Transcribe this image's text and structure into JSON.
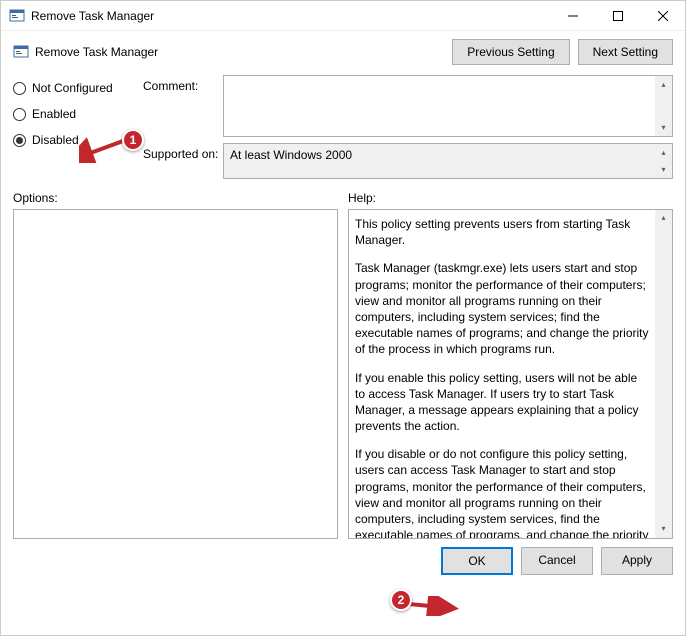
{
  "window": {
    "title": "Remove Task Manager",
    "policy_name": "Remove Task Manager"
  },
  "nav": {
    "previous": "Previous Setting",
    "next": "Next Setting"
  },
  "config": {
    "not_configured": "Not Configured",
    "enabled": "Enabled",
    "disabled": "Disabled",
    "selected": "disabled"
  },
  "fields": {
    "comment_label": "Comment:",
    "comment_value": "",
    "supported_label": "Supported on:",
    "supported_value": "At least Windows 2000"
  },
  "sections": {
    "options_label": "Options:",
    "help_label": "Help:"
  },
  "help": {
    "p1": "This policy setting prevents users from starting Task Manager.",
    "p2": "Task Manager (taskmgr.exe) lets users start and stop programs; monitor the performance of their computers; view and monitor all programs running on their computers, including system services; find the executable names of programs; and change the priority of the process in which programs run.",
    "p3": "If you enable this policy setting, users will not be able to access Task Manager. If users try to start Task Manager, a message appears explaining that a policy prevents the action.",
    "p4": "If you disable or do not configure this policy setting, users can access Task Manager to  start and stop programs, monitor the performance of their computers, view and monitor all programs running on their computers, including system services, find the executable names of programs, and change the priority of the process in which programs run."
  },
  "footer": {
    "ok": "OK",
    "cancel": "Cancel",
    "apply": "Apply"
  },
  "annotations": {
    "badge1": "1",
    "badge2": "2"
  }
}
